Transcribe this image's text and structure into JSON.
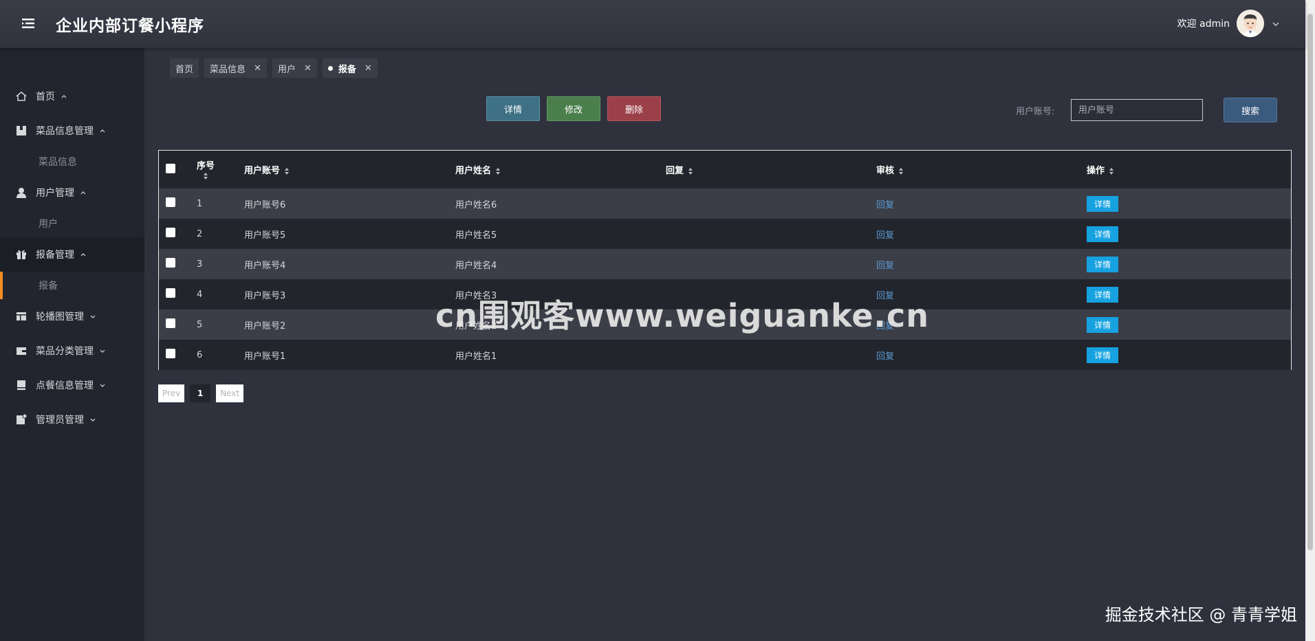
{
  "header": {
    "app_title": "企业内部订餐小程序",
    "welcome": "欢迎 admin"
  },
  "sidebar": {
    "items": [
      {
        "label": "首页",
        "icon": "home-icon",
        "expanded": true,
        "subs": []
      },
      {
        "label": "菜品信息管理",
        "icon": "book-icon",
        "expanded": true,
        "subs": [
          "菜品信息"
        ]
      },
      {
        "label": "用户管理",
        "icon": "user-icon",
        "expanded": true,
        "subs": [
          "用户"
        ]
      },
      {
        "label": "报备管理",
        "icon": "gift-icon",
        "expanded": true,
        "subs": [
          "报备"
        ],
        "active": true
      },
      {
        "label": "轮播图管理",
        "icon": "table-icon",
        "expanded": false,
        "subs": []
      },
      {
        "label": "菜品分类管理",
        "icon": "wallet-icon",
        "expanded": false,
        "subs": []
      },
      {
        "label": "点餐信息管理",
        "icon": "book-icon",
        "expanded": false,
        "subs": []
      },
      {
        "label": "管理员管理",
        "icon": "admin-icon",
        "expanded": false,
        "subs": []
      }
    ]
  },
  "tabs": [
    {
      "label": "首页",
      "closable": false
    },
    {
      "label": "菜品信息",
      "closable": true
    },
    {
      "label": "用户",
      "closable": true
    },
    {
      "label": "报备",
      "closable": true,
      "current": true
    }
  ],
  "toolbar": {
    "detail_label": "详情",
    "edit_label": "修改",
    "delete_label": "删除",
    "search_label": "用户账号:",
    "search_placeholder": "用户账号",
    "search_button": "搜索"
  },
  "table": {
    "headers": {
      "index": "序号",
      "account": "用户账号",
      "name": "用户姓名",
      "reply": "回复",
      "review": "审核",
      "action": "操作"
    },
    "rows": [
      {
        "index": "1",
        "account": "用户账号6",
        "name": "用户姓名6",
        "reply": "",
        "review": "回复",
        "action": "详情"
      },
      {
        "index": "2",
        "account": "用户账号5",
        "name": "用户姓名5",
        "reply": "",
        "review": "回复",
        "action": "详情"
      },
      {
        "index": "3",
        "account": "用户账号4",
        "name": "用户姓名4",
        "reply": "",
        "review": "回复",
        "action": "详情"
      },
      {
        "index": "4",
        "account": "用户账号3",
        "name": "用户姓名3",
        "reply": "",
        "review": "回复",
        "action": "详情"
      },
      {
        "index": "5",
        "account": "用户账号2",
        "name": "用户姓名2",
        "reply": "",
        "review": "回复",
        "action": "详情"
      },
      {
        "index": "6",
        "account": "用户账号1",
        "name": "用户姓名1",
        "reply": "",
        "review": "回复",
        "action": "详情"
      }
    ]
  },
  "pagination": {
    "prev": "Prev",
    "current": "1",
    "next": "Next"
  },
  "watermarks": {
    "center": "cn围观客www.weiguanke.cn",
    "corner": "掘金技术社区 @ 青青学姐"
  },
  "colors": {
    "accent": "#f08c20",
    "detail_button": "#16a2e0",
    "link": "#5b9bd5"
  }
}
